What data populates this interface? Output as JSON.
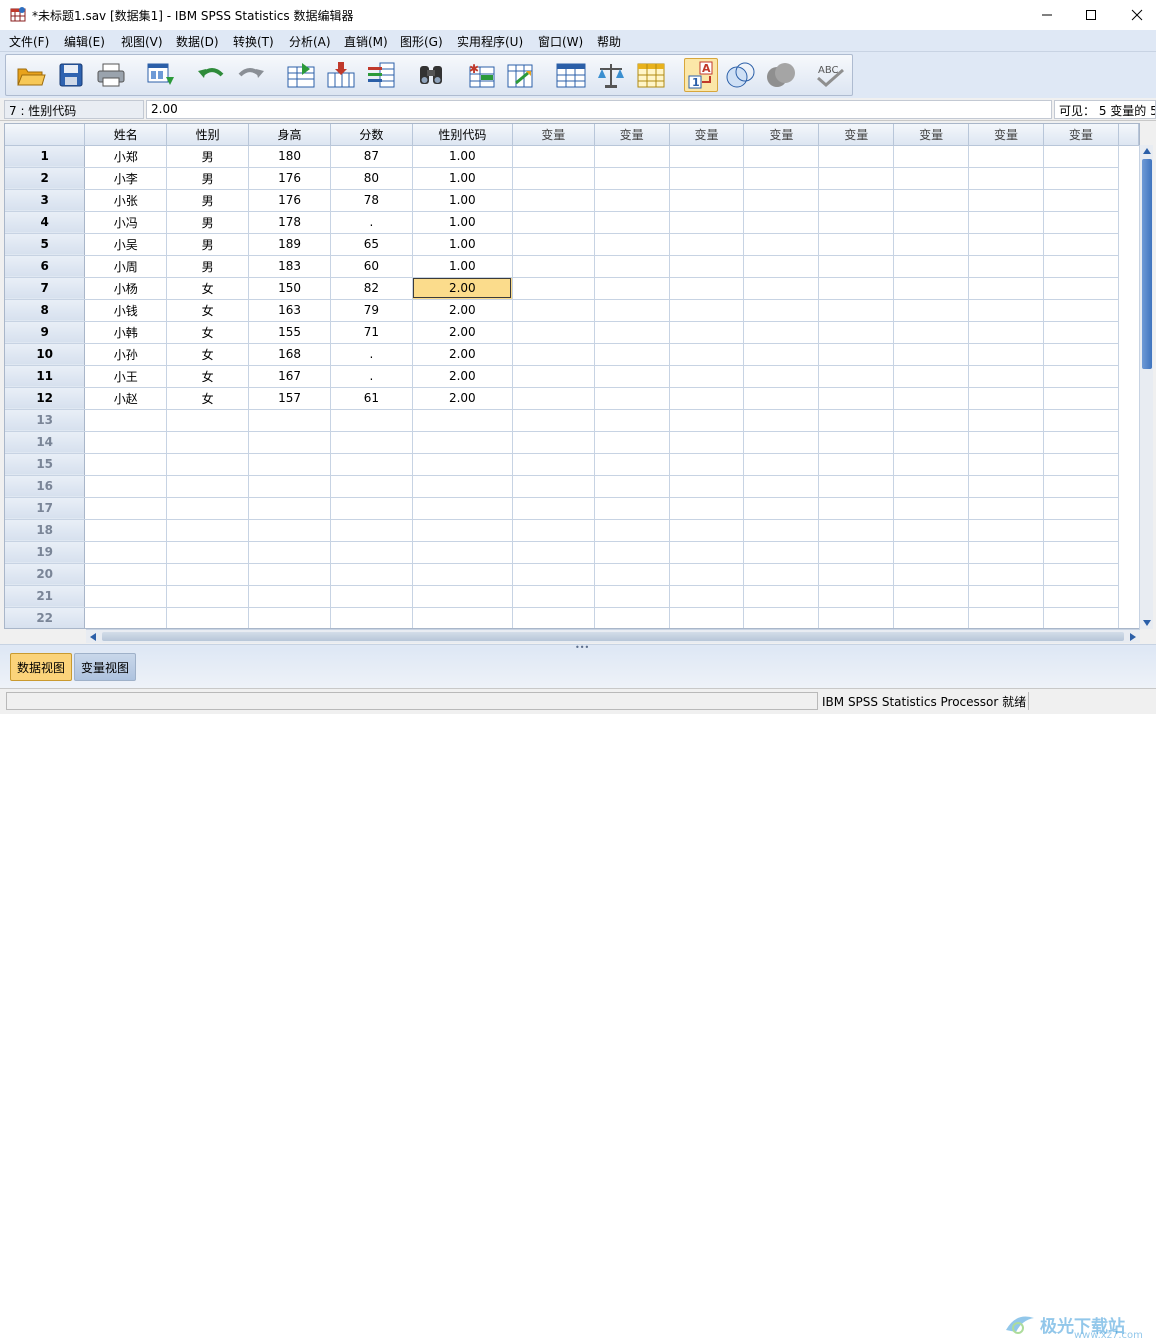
{
  "window": {
    "title": "*未标题1.sav [数据集1] - IBM SPSS Statistics 数据编辑器"
  },
  "menu": [
    "文件(F)",
    "编辑(E)",
    "视图(V)",
    "数据(D)",
    "转换(T)",
    "分析(A)",
    "直销(M)",
    "图形(G)",
    "实用程序(U)",
    "窗口(W)",
    "帮助"
  ],
  "toolbar": {
    "buttons": [
      "open-folder-icon",
      "save-icon",
      "print-icon",
      "dialog-recall-icon",
      "undo-icon",
      "redo-icon",
      "goto-case-icon",
      "goto-variable-icon",
      "variables-icon",
      "find-icon",
      "insert-cases-icon",
      "insert-variable-icon",
      "split-file-icon",
      "weight-cases-icon",
      "select-cases-icon",
      "value-labels-icon",
      "use-sets-icon",
      "show-all-variables-icon",
      "spell-check-icon"
    ]
  },
  "editor": {
    "cell_ref": "7 : 性别代码",
    "cell_value": "2.00",
    "visible": "可见： 5 变量的 5"
  },
  "grid": {
    "columns": [
      "姓名",
      "性别",
      "身高",
      "分数",
      "性别代码",
      "变量",
      "变量",
      "变量",
      "变量",
      "变量",
      "变量",
      "变量",
      "变量"
    ],
    "rows": [
      [
        "1",
        "小郑",
        "男",
        "180",
        "87",
        "1.00"
      ],
      [
        "2",
        "小李",
        "男",
        "176",
        "80",
        "1.00"
      ],
      [
        "3",
        "小张",
        "男",
        "176",
        "78",
        "1.00"
      ],
      [
        "4",
        "小冯",
        "男",
        "178",
        ".",
        "1.00"
      ],
      [
        "5",
        "小吴",
        "男",
        "189",
        "65",
        "1.00"
      ],
      [
        "6",
        "小周",
        "男",
        "183",
        "60",
        "1.00"
      ],
      [
        "7",
        "小杨",
        "女",
        "150",
        "82",
        "2.00"
      ],
      [
        "8",
        "小钱",
        "女",
        "163",
        "79",
        "2.00"
      ],
      [
        "9",
        "小韩",
        "女",
        "155",
        "71",
        "2.00"
      ],
      [
        "10",
        "小孙",
        "女",
        "168",
        ".",
        "2.00"
      ],
      [
        "11",
        "小王",
        "女",
        "167",
        ".",
        "2.00"
      ],
      [
        "12",
        "小赵",
        "女",
        "157",
        "61",
        "2.00"
      ]
    ],
    "empty_rows": [
      "13",
      "14",
      "15",
      "16",
      "17",
      "18",
      "19",
      "20",
      "21",
      "22"
    ],
    "selected_row": 7,
    "selected_col": 5
  },
  "tabs": {
    "data_view": "数据视图",
    "variable_view": "变量视图"
  },
  "watermark": {
    "text": "极光下载站",
    "url": "www.xz7.com"
  },
  "status": {
    "processor": "IBM SPSS Statistics Processor 就绪"
  },
  "colors": {
    "selected_cell": "#fbdc8c",
    "active_tab": "#fbd37a",
    "menu_bg": "#dfe8f5"
  }
}
